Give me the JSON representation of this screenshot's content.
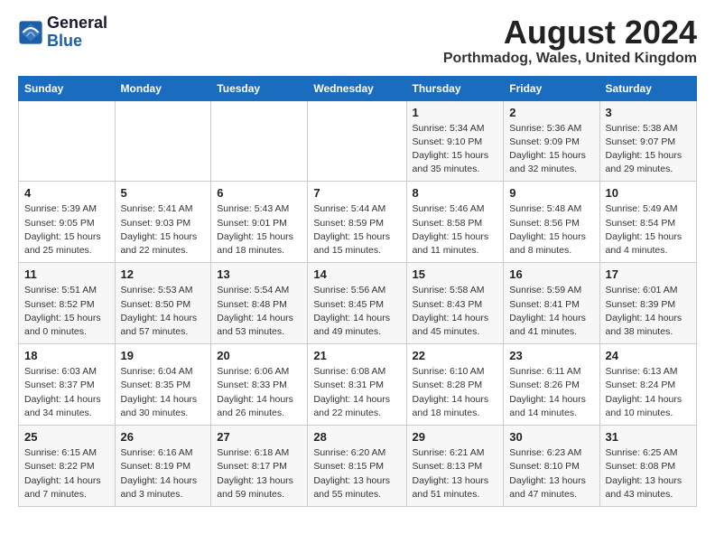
{
  "logo": {
    "line1": "General",
    "line2": "Blue"
  },
  "title": "August 2024",
  "location": "Porthmadog, Wales, United Kingdom",
  "days_of_week": [
    "Sunday",
    "Monday",
    "Tuesday",
    "Wednesday",
    "Thursday",
    "Friday",
    "Saturday"
  ],
  "weeks": [
    [
      {
        "day": "",
        "info": ""
      },
      {
        "day": "",
        "info": ""
      },
      {
        "day": "",
        "info": ""
      },
      {
        "day": "",
        "info": ""
      },
      {
        "day": "1",
        "info": "Sunrise: 5:34 AM\nSunset: 9:10 PM\nDaylight: 15 hours\nand 35 minutes."
      },
      {
        "day": "2",
        "info": "Sunrise: 5:36 AM\nSunset: 9:09 PM\nDaylight: 15 hours\nand 32 minutes."
      },
      {
        "day": "3",
        "info": "Sunrise: 5:38 AM\nSunset: 9:07 PM\nDaylight: 15 hours\nand 29 minutes."
      }
    ],
    [
      {
        "day": "4",
        "info": "Sunrise: 5:39 AM\nSunset: 9:05 PM\nDaylight: 15 hours\nand 25 minutes."
      },
      {
        "day": "5",
        "info": "Sunrise: 5:41 AM\nSunset: 9:03 PM\nDaylight: 15 hours\nand 22 minutes."
      },
      {
        "day": "6",
        "info": "Sunrise: 5:43 AM\nSunset: 9:01 PM\nDaylight: 15 hours\nand 18 minutes."
      },
      {
        "day": "7",
        "info": "Sunrise: 5:44 AM\nSunset: 8:59 PM\nDaylight: 15 hours\nand 15 minutes."
      },
      {
        "day": "8",
        "info": "Sunrise: 5:46 AM\nSunset: 8:58 PM\nDaylight: 15 hours\nand 11 minutes."
      },
      {
        "day": "9",
        "info": "Sunrise: 5:48 AM\nSunset: 8:56 PM\nDaylight: 15 hours\nand 8 minutes."
      },
      {
        "day": "10",
        "info": "Sunrise: 5:49 AM\nSunset: 8:54 PM\nDaylight: 15 hours\nand 4 minutes."
      }
    ],
    [
      {
        "day": "11",
        "info": "Sunrise: 5:51 AM\nSunset: 8:52 PM\nDaylight: 15 hours\nand 0 minutes."
      },
      {
        "day": "12",
        "info": "Sunrise: 5:53 AM\nSunset: 8:50 PM\nDaylight: 14 hours\nand 57 minutes."
      },
      {
        "day": "13",
        "info": "Sunrise: 5:54 AM\nSunset: 8:48 PM\nDaylight: 14 hours\nand 53 minutes."
      },
      {
        "day": "14",
        "info": "Sunrise: 5:56 AM\nSunset: 8:45 PM\nDaylight: 14 hours\nand 49 minutes."
      },
      {
        "day": "15",
        "info": "Sunrise: 5:58 AM\nSunset: 8:43 PM\nDaylight: 14 hours\nand 45 minutes."
      },
      {
        "day": "16",
        "info": "Sunrise: 5:59 AM\nSunset: 8:41 PM\nDaylight: 14 hours\nand 41 minutes."
      },
      {
        "day": "17",
        "info": "Sunrise: 6:01 AM\nSunset: 8:39 PM\nDaylight: 14 hours\nand 38 minutes."
      }
    ],
    [
      {
        "day": "18",
        "info": "Sunrise: 6:03 AM\nSunset: 8:37 PM\nDaylight: 14 hours\nand 34 minutes."
      },
      {
        "day": "19",
        "info": "Sunrise: 6:04 AM\nSunset: 8:35 PM\nDaylight: 14 hours\nand 30 minutes."
      },
      {
        "day": "20",
        "info": "Sunrise: 6:06 AM\nSunset: 8:33 PM\nDaylight: 14 hours\nand 26 minutes."
      },
      {
        "day": "21",
        "info": "Sunrise: 6:08 AM\nSunset: 8:31 PM\nDaylight: 14 hours\nand 22 minutes."
      },
      {
        "day": "22",
        "info": "Sunrise: 6:10 AM\nSunset: 8:28 PM\nDaylight: 14 hours\nand 18 minutes."
      },
      {
        "day": "23",
        "info": "Sunrise: 6:11 AM\nSunset: 8:26 PM\nDaylight: 14 hours\nand 14 minutes."
      },
      {
        "day": "24",
        "info": "Sunrise: 6:13 AM\nSunset: 8:24 PM\nDaylight: 14 hours\nand 10 minutes."
      }
    ],
    [
      {
        "day": "25",
        "info": "Sunrise: 6:15 AM\nSunset: 8:22 PM\nDaylight: 14 hours\nand 7 minutes."
      },
      {
        "day": "26",
        "info": "Sunrise: 6:16 AM\nSunset: 8:19 PM\nDaylight: 14 hours\nand 3 minutes."
      },
      {
        "day": "27",
        "info": "Sunrise: 6:18 AM\nSunset: 8:17 PM\nDaylight: 13 hours\nand 59 minutes."
      },
      {
        "day": "28",
        "info": "Sunrise: 6:20 AM\nSunset: 8:15 PM\nDaylight: 13 hours\nand 55 minutes."
      },
      {
        "day": "29",
        "info": "Sunrise: 6:21 AM\nSunset: 8:13 PM\nDaylight: 13 hours\nand 51 minutes."
      },
      {
        "day": "30",
        "info": "Sunrise: 6:23 AM\nSunset: 8:10 PM\nDaylight: 13 hours\nand 47 minutes."
      },
      {
        "day": "31",
        "info": "Sunrise: 6:25 AM\nSunset: 8:08 PM\nDaylight: 13 hours\nand 43 minutes."
      }
    ]
  ]
}
